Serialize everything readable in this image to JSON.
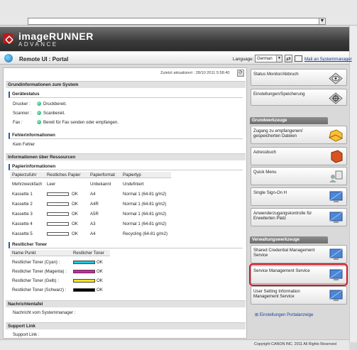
{
  "browser": {
    "address": "",
    "dropdown_arrow": "▼"
  },
  "brand": {
    "line1": "imageRUNNER",
    "line2": "ADVANCE"
  },
  "portal": {
    "title": "Remote UI : Portal",
    "language_label": "Language:",
    "language_value": "German",
    "mail_link": "Mail an Systemmanager"
  },
  "updated": "Zuletzt aktualisiert : 28/10 2011 5:58:40",
  "sections": {
    "basic": "Grundinformationen zum System",
    "device_status": "Gerätestatus",
    "errors": "Fehlerinformationen",
    "resources": "Informationen über Ressourcen",
    "paper": "Papierinformationen",
    "toner": "Restlicher Toner",
    "messages": "Nachrichtentafel",
    "support": "Support Link"
  },
  "status": [
    {
      "label": "Drucker :",
      "text": "Druckbereit."
    },
    {
      "label": "Scanner :",
      "text": "Scanbereit."
    },
    {
      "label": "Fax :",
      "text": "Bereit für Fax senden oder empfangen."
    }
  ],
  "error_text": "Kein Fehler",
  "paper_table": {
    "headers": [
      "Papierzufuhr",
      "Restliches Papier",
      "Papierformat",
      "Papiertyp"
    ],
    "rows": [
      {
        "source": "Mehrzweckfach",
        "remaining": "Leer",
        "fill": 0,
        "show_bar": false,
        "format": "Unbekannt",
        "type": "Undefiniert"
      },
      {
        "source": "Kassette 1",
        "remaining": "OK",
        "fill": 0,
        "show_bar": true,
        "format": "A4",
        "type": "Normal 1 (64-81 g/m2)"
      },
      {
        "source": "Kassette 2",
        "remaining": "OK",
        "fill": 0,
        "show_bar": true,
        "format": "A4R",
        "type": "Normal 1 (64-81 g/m2)"
      },
      {
        "source": "Kassette 3",
        "remaining": "OK",
        "fill": 0,
        "show_bar": true,
        "format": "A5R",
        "type": "Normal 1 (64-81 g/m2)"
      },
      {
        "source": "Kassette 4",
        "remaining": "OK",
        "fill": 0,
        "show_bar": true,
        "format": "A3",
        "type": "Normal 1 (64-81 g/m2)"
      },
      {
        "source": "Kassette 5",
        "remaining": "OK",
        "fill": 0,
        "show_bar": true,
        "format": "A4",
        "type": "Recycling (64-81 g/m2)"
      }
    ]
  },
  "toner_table": {
    "headers": [
      "Name Punkt",
      "Restlicher Toner"
    ],
    "rows": [
      {
        "name": "Restlicher Toner (Cyan) :",
        "status": "OK",
        "color": "#19c7e0"
      },
      {
        "name": "Restlicher Toner (Magenta) :",
        "status": "OK",
        "color": "#e01aa8"
      },
      {
        "name": "Restlicher Toner (Gelb) :",
        "status": "OK",
        "color": "#f2e51a"
      },
      {
        "name": "Restlicher Toner (Schwarz) :",
        "status": "OK",
        "color": "#000000"
      }
    ]
  },
  "message_text": "Nachricht vom Systemmanager :",
  "support_text": "Support Link :",
  "nav": {
    "top": [
      {
        "label": "Status Monitor/Abbruch",
        "icon": "status-eye-icon"
      },
      {
        "label": "Einstellungen/Speicherung",
        "icon": "settings-gear-icon"
      }
    ],
    "basic_tools_header": "Grundwerkzeuge",
    "basic_tools": [
      {
        "label": "Zugang zu empfangenen/ gespeicherten Dateien",
        "icon": "folder-icon"
      },
      {
        "label": "Adressbuch",
        "icon": "address-book-icon"
      },
      {
        "label": "Quick Menu",
        "icon": "quick-menu-icon"
      },
      {
        "label": "Single Sign-On H",
        "icon": "monitor-icon"
      },
      {
        "label": "Anwenderzugangskontrolle für Erweiterten Platz",
        "icon": "monitor-icon"
      }
    ],
    "admin_tools_header": "Verwaltungswerkzeuge",
    "admin_tools": [
      {
        "label": "Shared Credential Management Service",
        "icon": "monitor-icon"
      },
      {
        "label": "Service Management Service",
        "icon": "monitor-icon"
      },
      {
        "label": "User Setting Information Management Service",
        "icon": "monitor-icon"
      }
    ],
    "portal_settings": "Einstellungen Portalanzeige"
  },
  "footer": {
    "copyright": "Copyright CANON INC. 2011 All Rights Reserved"
  },
  "colors": {
    "highlight": "#d11a2a",
    "link": "#1a3f99",
    "banner": "#3a3a3a"
  }
}
